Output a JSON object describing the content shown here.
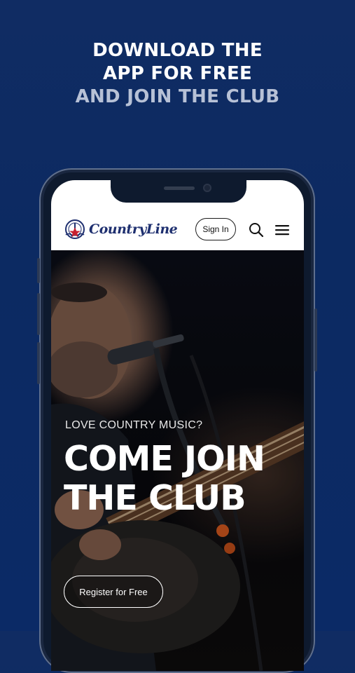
{
  "promo": {
    "line1": "DOWNLOAD THE",
    "line2": "APP FOR FREE",
    "line3": "AND JOIN THE CLUB"
  },
  "header": {
    "logo_text": "CountryLine",
    "signin_label": "Sign In",
    "search_icon": "search-icon",
    "menu_icon": "menu-icon"
  },
  "hero": {
    "kicker": "LOVE COUNTRY MUSIC?",
    "headline_line1": "COME JOIN",
    "headline_line2": "THE CLUB",
    "cta_label": "Register for Free"
  },
  "colors": {
    "background": "#0b2a66",
    "promo_highlight": "#ffffff",
    "promo_muted": "#b7c1d6",
    "brand": "#1e2f6f",
    "brand_accent": "#c8202f"
  }
}
